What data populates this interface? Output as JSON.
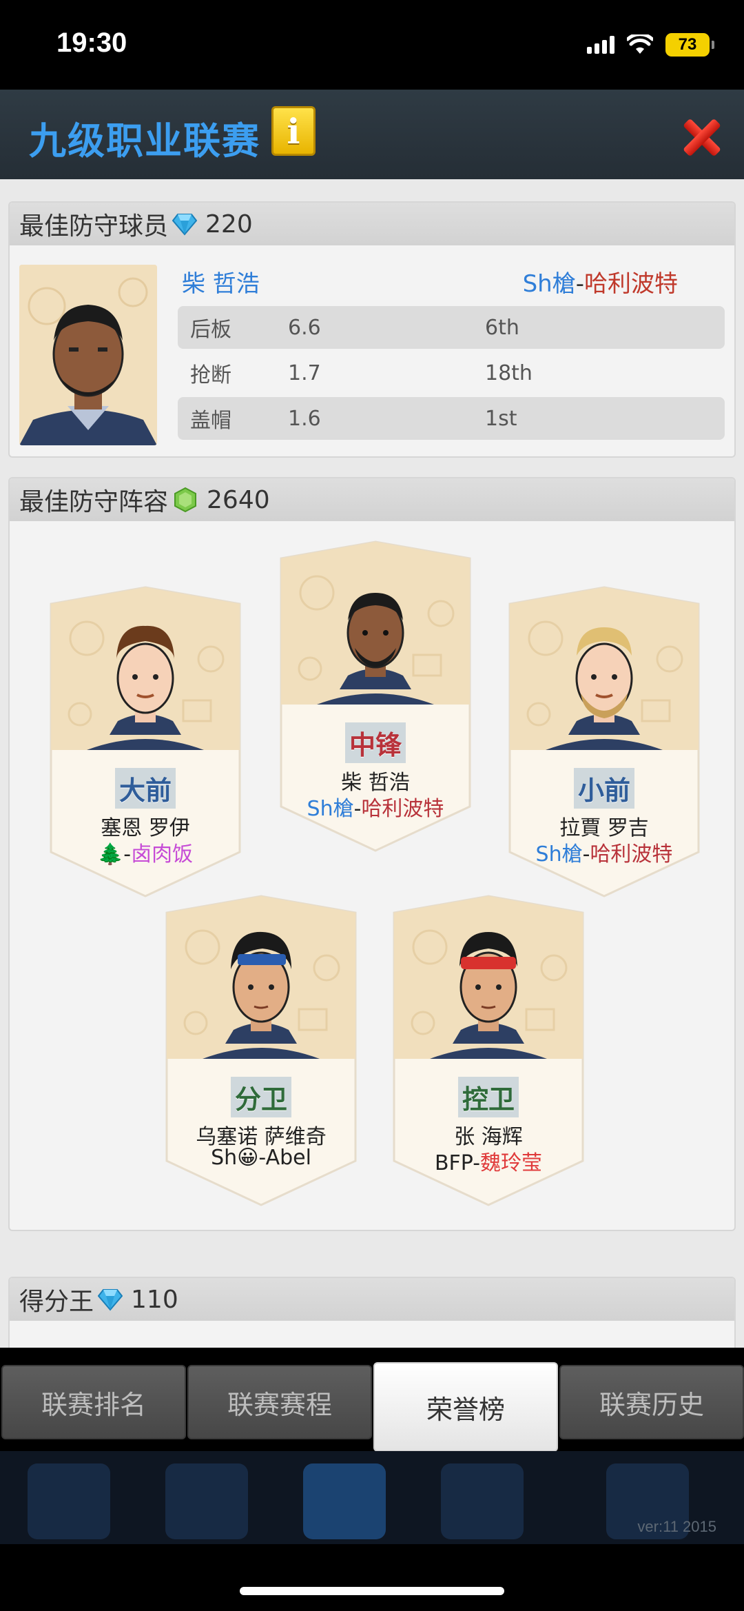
{
  "status": {
    "time": "19:30",
    "battery": "73"
  },
  "header": {
    "title": "九级职业联赛",
    "info_glyph": "i"
  },
  "best_defender": {
    "title": "最佳防守球员",
    "reward": "220",
    "player_name": "柴 哲浩",
    "team_prefix": "Sh槍",
    "team_sep": "-",
    "team_name": "哈利波特",
    "stats": [
      {
        "label": "后板",
        "value": "6.6",
        "rank": "6th"
      },
      {
        "label": "抢断",
        "value": "1.7",
        "rank": "18th"
      },
      {
        "label": "盖帽",
        "value": "1.6",
        "rank": "1st"
      }
    ]
  },
  "best_lineup": {
    "title": "最佳防守阵容",
    "reward": "2640",
    "cards": [
      {
        "position": "大前",
        "name": "塞恩 罗伊",
        "team_prefix": "🌲",
        "team_sep": "-",
        "team_name": "卤肉饭"
      },
      {
        "position": "中锋",
        "name": "柴 哲浩",
        "team_prefix": "Sh槍",
        "team_sep": "-",
        "team_name": "哈利波特"
      },
      {
        "position": "小前",
        "name": "拉賈 罗吉",
        "team_prefix": "Sh槍",
        "team_sep": "-",
        "team_name": "哈利波特"
      },
      {
        "position": "分卫",
        "name": "乌塞诺 萨维奇",
        "team_prefix": "Sh😀",
        "team_sep": "-",
        "team_name": "Abel"
      },
      {
        "position": "控卫",
        "name": "张 海辉",
        "team_prefix": "BFP",
        "team_sep": "-",
        "team_name": "魏玲莹"
      }
    ]
  },
  "top_scorer": {
    "title": "得分王",
    "reward": "110"
  },
  "tabs": [
    "联赛排名",
    "联赛赛程",
    "荣誉榜",
    "联赛历史"
  ],
  "active_tab": "荣誉榜",
  "version": "ver:11  2015",
  "icons": {
    "gem": "diamond-icon",
    "lineup": "hex-badge-icon",
    "close": "close-icon",
    "info": "info-icon"
  }
}
